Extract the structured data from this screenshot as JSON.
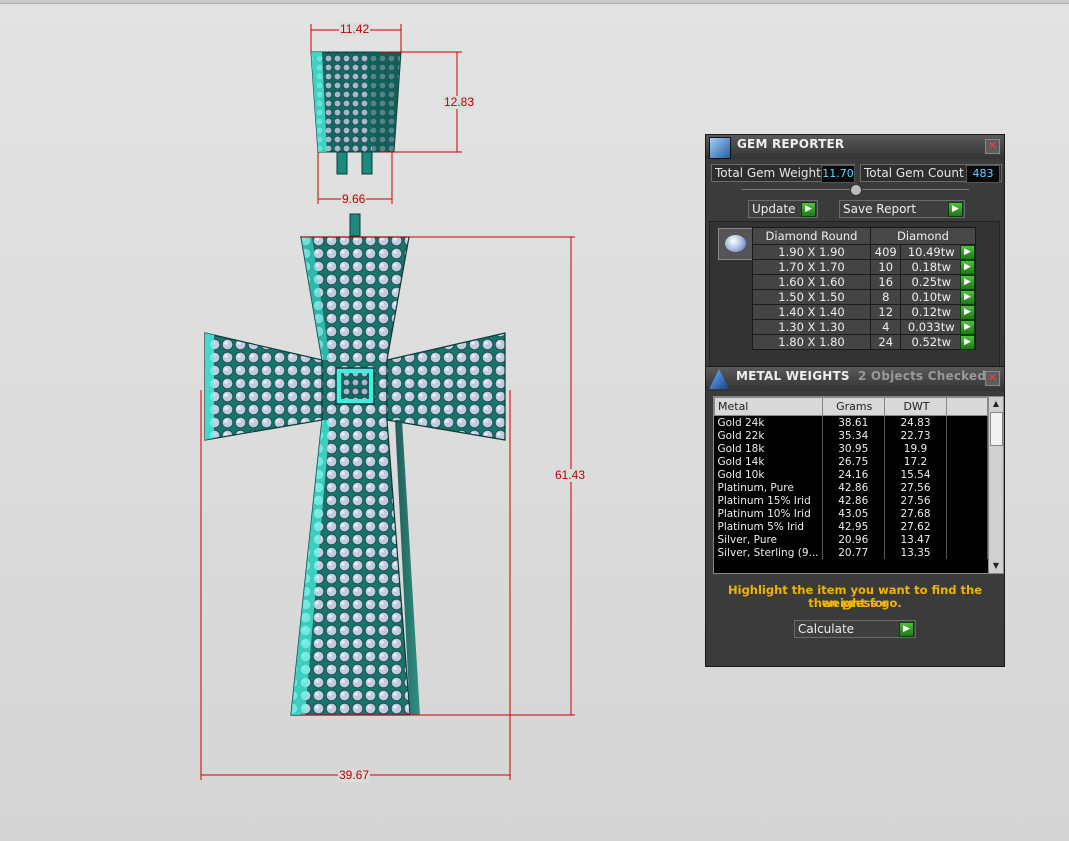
{
  "dimensions": {
    "top_width": "11.42",
    "top_height": "12.83",
    "bail_base_width": "9.66",
    "cross_height": "61.43",
    "cross_width": "39.67"
  },
  "gem_reporter": {
    "title": "GEM REPORTER",
    "total_weight_label": "Total Gem Weight",
    "total_weight_value": "11.70",
    "total_count_label": "Total Gem Count",
    "total_count_value": "483",
    "update_label": "Update",
    "save_report_label": "Save Report",
    "col_shape": "Diamond Round",
    "col_material": "Diamond",
    "rows": [
      {
        "size": "1.90 X 1.90",
        "count": "409",
        "weight": "10.49tw"
      },
      {
        "size": "1.70 X 1.70",
        "count": "10",
        "weight": "0.18tw"
      },
      {
        "size": "1.60 X 1.60",
        "count": "16",
        "weight": "0.25tw"
      },
      {
        "size": "1.50 X 1.50",
        "count": "8",
        "weight": "0.10tw"
      },
      {
        "size": "1.40 X 1.40",
        "count": "12",
        "weight": "0.12tw"
      },
      {
        "size": "1.30 X 1.30",
        "count": "4",
        "weight": "0.033tw"
      },
      {
        "size": "1.80 X 1.80",
        "count": "24",
        "weight": "0.52tw"
      }
    ]
  },
  "metal_weights": {
    "title": "METAL WEIGHTS",
    "objects_checked": "2 Objects Checked",
    "col_metal": "Metal",
    "col_grams": "Grams",
    "col_dwt": "DWT",
    "rows": [
      {
        "metal": "Gold 24k",
        "grams": "38.61",
        "dwt": "24.83"
      },
      {
        "metal": "Gold 22k",
        "grams": "35.34",
        "dwt": "22.73"
      },
      {
        "metal": "Gold 18k",
        "grams": "30.95",
        "dwt": "19.9"
      },
      {
        "metal": "Gold 14k",
        "grams": "26.75",
        "dwt": "17.2"
      },
      {
        "metal": "Gold 10k",
        "grams": "24.16",
        "dwt": "15.54"
      },
      {
        "metal": "Platinum, Pure",
        "grams": "42.86",
        "dwt": "27.56"
      },
      {
        "metal": "Platinum 15% Irid",
        "grams": "42.86",
        "dwt": "27.56"
      },
      {
        "metal": "Platinum 10% Irid",
        "grams": "43.05",
        "dwt": "27.68"
      },
      {
        "metal": "Platinum 5% Irid",
        "grams": "42.95",
        "dwt": "27.62"
      },
      {
        "metal": "Silver, Pure",
        "grams": "20.96",
        "dwt": "13.47"
      },
      {
        "metal": "Silver, Sterling (9...",
        "grams": "20.77",
        "dwt": "13.35"
      }
    ],
    "hint_line1": "Highlight the item you want to find the weight for",
    "hint_line2": "then press go.",
    "calculate_label": "Calculate"
  },
  "colors": {
    "dimension_line": "#cc0000",
    "model_teal": "#1e8f80",
    "model_highlight": "#3ff0e0",
    "gem_fill": "#b8c4d8",
    "go_button": "#2e9a22",
    "hint_text": "#f0b400"
  }
}
